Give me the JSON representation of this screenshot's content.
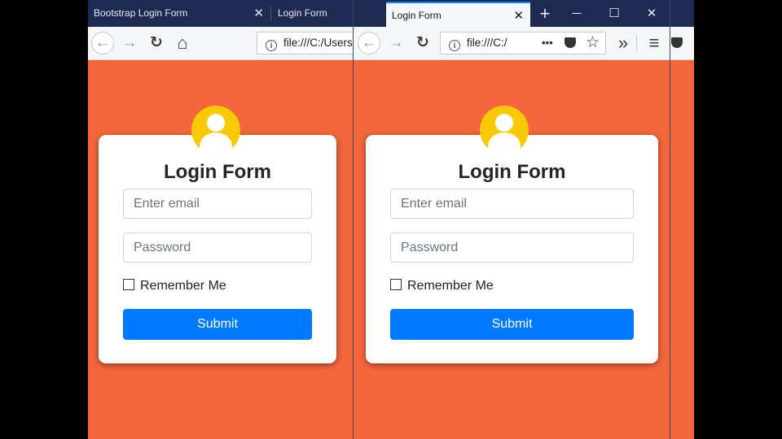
{
  "windows": [
    {
      "id": "left",
      "tabs": [
        {
          "title": "Bootstrap Login Form",
          "active": false,
          "closable": true
        },
        {
          "title": "Login Form",
          "active": false,
          "closable": false
        }
      ],
      "nav": {
        "back": "←",
        "forward": "→",
        "reload": "↻",
        "home": "⌂"
      },
      "url": "file:///C:/Users"
    },
    {
      "id": "right",
      "tabs": [
        {
          "title": "Login Form",
          "active": true,
          "closable": true
        }
      ],
      "new_tab": "+",
      "window_controls": {
        "minimize": "─",
        "maximize": "☐",
        "close": "✕"
      },
      "nav": {
        "back": "←",
        "forward": "→",
        "reload": "↻",
        "more": "•••",
        "pocket": "pocket",
        "bookmark": "☆",
        "overflow": "»",
        "menu": "≡"
      },
      "url": "file:///C:/"
    }
  ],
  "form": {
    "title": "Login Form",
    "email_placeholder": "Enter email",
    "password_placeholder": "Password",
    "remember_label": "Remember Me",
    "remember_checked": false,
    "submit_label": "Submit"
  },
  "colors": {
    "background": "#f4673b",
    "avatar": "#f9c908",
    "submit": "#007bff",
    "tabbar": "#1e2a52"
  }
}
